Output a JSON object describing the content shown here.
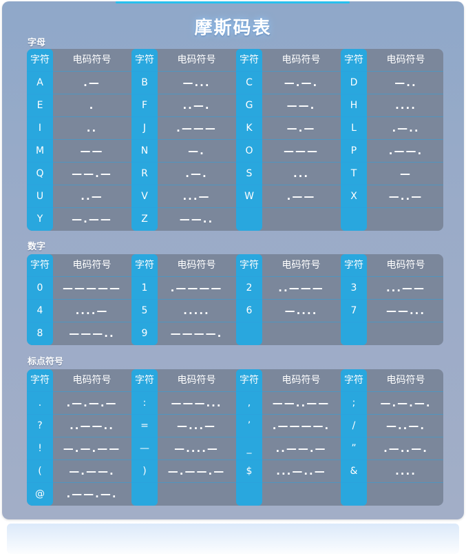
{
  "title": "摩斯码表",
  "header": {
    "char": "字符",
    "code": "电码符号"
  },
  "sections": [
    {
      "label": "字母",
      "rows": [
        [
          [
            "A",
            ".—"
          ],
          [
            "B",
            "—..."
          ],
          [
            "C",
            "—.—."
          ],
          [
            "D",
            "—.."
          ]
        ],
        [
          [
            "E",
            "."
          ],
          [
            "F",
            "..—."
          ],
          [
            "G",
            "——."
          ],
          [
            "H",
            "...."
          ]
        ],
        [
          [
            "I",
            ".."
          ],
          [
            "J",
            ".———"
          ],
          [
            "K",
            "—.—"
          ],
          [
            "L",
            ".—.."
          ]
        ],
        [
          [
            "M",
            "——"
          ],
          [
            "N",
            "—."
          ],
          [
            "O",
            "———"
          ],
          [
            "P",
            ".——."
          ]
        ],
        [
          [
            "Q",
            "——.—"
          ],
          [
            "R",
            ".—."
          ],
          [
            "S",
            "..."
          ],
          [
            "T",
            "—"
          ]
        ],
        [
          [
            "U",
            "..—"
          ],
          [
            "V",
            "...—"
          ],
          [
            "W",
            ".——"
          ],
          [
            "X",
            "—..—"
          ]
        ],
        [
          [
            "Y",
            "—.——"
          ],
          [
            "Z",
            "——.."
          ],
          [
            "",
            ""
          ],
          [
            "",
            ""
          ]
        ]
      ]
    },
    {
      "label": "数字",
      "rows": [
        [
          [
            "0",
            "—————"
          ],
          [
            "1",
            ".————"
          ],
          [
            "2",
            "..———"
          ],
          [
            "3",
            "...——"
          ]
        ],
        [
          [
            "4",
            "....—"
          ],
          [
            "5",
            "....."
          ],
          [
            "6",
            "—...."
          ],
          [
            "7",
            "——..."
          ]
        ],
        [
          [
            "8",
            "———.."
          ],
          [
            "9",
            "————."
          ],
          [
            "",
            ""
          ],
          [
            "",
            ""
          ]
        ]
      ]
    },
    {
      "label": "标点符号",
      "rows": [
        [
          [
            ".",
            ".—.—.—"
          ],
          [
            ":",
            "———..."
          ],
          [
            ",",
            "——..——"
          ],
          [
            ";",
            "—.—.—."
          ]
        ],
        [
          [
            "?",
            "..——.."
          ],
          [
            "=",
            "—...—"
          ],
          [
            "’",
            ".————."
          ],
          [
            "/",
            "—..—."
          ]
        ],
        [
          [
            "!",
            "—.—.——"
          ],
          [
            "—",
            "—....—"
          ],
          [
            "_",
            "..——.—"
          ],
          [
            "”",
            ".—..—."
          ]
        ],
        [
          [
            "(",
            "—.——."
          ],
          [
            ")",
            "—.——.—"
          ],
          [
            "$",
            "...—..—"
          ],
          [
            "&",
            "...."
          ]
        ],
        [
          [
            "@",
            ".——.—."
          ],
          [
            "",
            ""
          ],
          [
            "",
            ""
          ],
          [
            "",
            ""
          ]
        ]
      ]
    }
  ]
}
